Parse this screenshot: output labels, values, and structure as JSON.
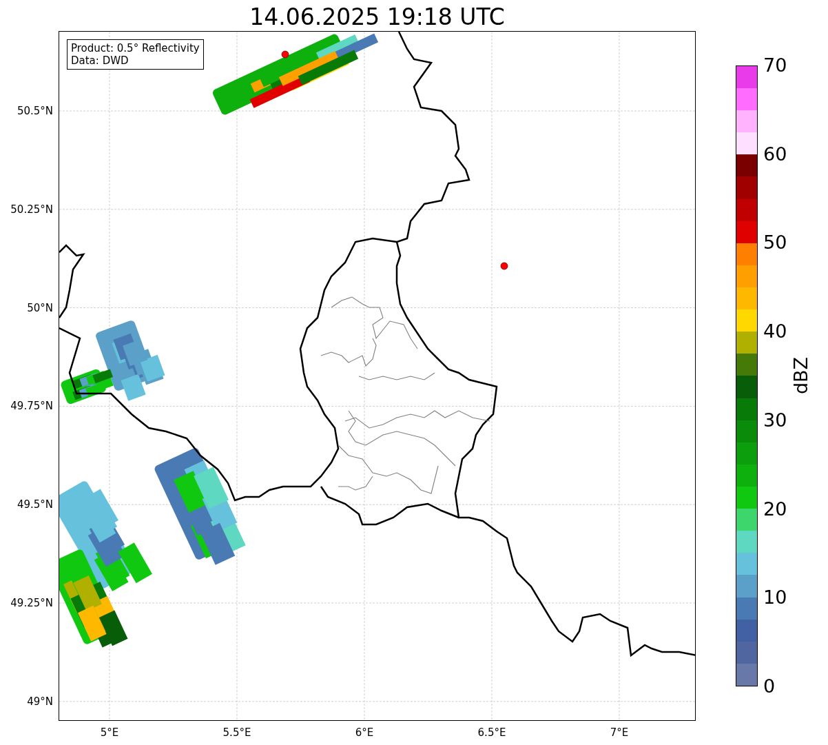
{
  "title": "14.06.2025 19:18 UTC",
  "legend": [
    "Product: 0.5° Reflectivity",
    "Data: DWD"
  ],
  "y_ticks": [
    "50.5°N",
    "50.25°N",
    "50°N",
    "49.75°N",
    "49.5°N",
    "49.25°N",
    "49°N"
  ],
  "x_ticks": [
    "5°E",
    "5.5°E",
    "6°E",
    "6.5°E",
    "7°E"
  ],
  "colorbar": {
    "label": "dBZ",
    "ticks": [
      "70",
      "60",
      "50",
      "40",
      "30",
      "20",
      "10",
      "0"
    ],
    "segments": [
      {
        "color": "#6878a8"
      },
      {
        "color": "#5066a0"
      },
      {
        "color": "#4260a4"
      },
      {
        "color": "#4a7ab4"
      },
      {
        "color": "#5aa0c8"
      },
      {
        "color": "#66c2dc"
      },
      {
        "color": "#5ed8c0"
      },
      {
        "color": "#3dd66c"
      },
      {
        "color": "#10c810"
      },
      {
        "color": "#0db00d"
      },
      {
        "color": "#0c9e0c"
      },
      {
        "color": "#0a8c0a"
      },
      {
        "color": "#087a08"
      },
      {
        "color": "#085e08"
      },
      {
        "color": "#457a08"
      },
      {
        "color": "#b0b000"
      },
      {
        "color": "#ffd800"
      },
      {
        "color": "#ffb800"
      },
      {
        "color": "#ff9f00"
      },
      {
        "color": "#ff7f00"
      },
      {
        "color": "#e00000"
      },
      {
        "color": "#c00000"
      },
      {
        "color": "#a00000"
      },
      {
        "color": "#7a0000"
      },
      {
        "color": "#ffdfff"
      },
      {
        "color": "#ffb3ff"
      },
      {
        "color": "#ff6cff"
      },
      {
        "color": "#e93be9"
      }
    ]
  }
}
